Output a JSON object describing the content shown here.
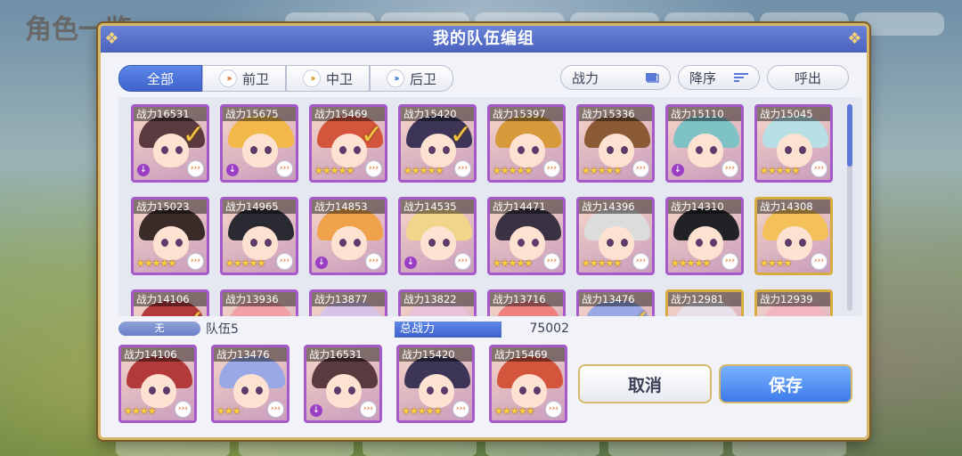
{
  "background": {
    "title": "角色一览"
  },
  "dialog": {
    "title": "我的队伍编组"
  },
  "filters": {
    "tabs": [
      {
        "label": "全部",
        "selected": true
      },
      {
        "label": "前卫"
      },
      {
        "label": "中卫"
      },
      {
        "label": "后卫"
      }
    ],
    "power_sort": "战力",
    "order": "降序",
    "recall": "呼出"
  },
  "roster": [
    {
      "power": "战力16531",
      "stars": "★",
      "checked": true,
      "down": true,
      "gold": false,
      "hair": "#5a3a3e"
    },
    {
      "power": "战力15675",
      "stars": "",
      "checked": false,
      "down": true,
      "gold": false,
      "hair": "#f2b84a"
    },
    {
      "power": "战力15469",
      "stars": "★★★★★",
      "checked": true,
      "down": false,
      "gold": false,
      "hair": "#d3553c"
    },
    {
      "power": "战力15420",
      "stars": "★★★★★",
      "checked": true,
      "down": false,
      "gold": false,
      "hair": "#3c3558"
    },
    {
      "power": "战力15397",
      "stars": "★★★★★",
      "checked": false,
      "down": false,
      "gold": false,
      "hair": "#d79a3a"
    },
    {
      "power": "战力15336",
      "stars": "★★★★★",
      "checked": false,
      "down": false,
      "gold": false,
      "hair": "#8a5a34"
    },
    {
      "power": "战力15110",
      "stars": "",
      "checked": false,
      "down": true,
      "gold": false,
      "hair": "#7fc2c6"
    },
    {
      "power": "战力15045",
      "stars": "★★★★★",
      "checked": false,
      "down": false,
      "gold": false,
      "hair": "#b9dfe6"
    },
    {
      "power": "战力15023",
      "stars": "★★★★★",
      "checked": false,
      "down": false,
      "gold": false,
      "hair": "#3a2a28"
    },
    {
      "power": "战力14965",
      "stars": "★★★★★",
      "checked": false,
      "down": false,
      "gold": false,
      "hair": "#2a2a33"
    },
    {
      "power": "战力14853",
      "stars": "",
      "checked": false,
      "down": true,
      "gold": false,
      "hair": "#f0a24a"
    },
    {
      "power": "战力14535",
      "stars": "",
      "checked": false,
      "down": true,
      "gold": false,
      "hair": "#f1d58a"
    },
    {
      "power": "战力14471",
      "stars": "★★★★★",
      "checked": false,
      "down": false,
      "gold": false,
      "hair": "#3a3142"
    },
    {
      "power": "战力14396",
      "stars": "★★★★★",
      "checked": false,
      "down": false,
      "gold": false,
      "hair": "#dcdcdc"
    },
    {
      "power": "战力14310",
      "stars": "★★★★★",
      "checked": false,
      "down": false,
      "gold": false,
      "hair": "#222226"
    },
    {
      "power": "战力14308",
      "stars": "★★★★",
      "checked": false,
      "down": false,
      "gold": true,
      "hair": "#f3c05a"
    },
    {
      "power": "战力14106",
      "stars": "",
      "checked": true,
      "down": false,
      "gold": false,
      "hair": "#b33a3a"
    },
    {
      "power": "战力13936",
      "stars": "",
      "checked": false,
      "down": false,
      "gold": false,
      "hair": "#f1a0a8"
    },
    {
      "power": "战力13877",
      "stars": "",
      "checked": false,
      "down": false,
      "gold": false,
      "hair": "#d7c3e6"
    },
    {
      "power": "战力13822",
      "stars": "",
      "checked": false,
      "down": false,
      "gold": false,
      "hair": "#e7c2d8"
    },
    {
      "power": "战力13716",
      "stars": "",
      "checked": false,
      "down": false,
      "gold": false,
      "hair": "#f08080"
    },
    {
      "power": "战力13476",
      "stars": "",
      "checked": true,
      "down": false,
      "gold": false,
      "hair": "#9aa8e6"
    },
    {
      "power": "战力12981",
      "stars": "",
      "checked": false,
      "down": false,
      "gold": true,
      "hair": "#e8e0e8"
    },
    {
      "power": "战力12939",
      "stars": "",
      "checked": false,
      "down": false,
      "gold": true,
      "hair": "#f2b6c2"
    }
  ],
  "team": {
    "tag": "无",
    "name": "队伍5",
    "total_label": "总战力",
    "total_value": "75002",
    "members": [
      {
        "power": "战力14106",
        "stars": "★★★★",
        "down": false,
        "hair": "#b33a3a"
      },
      {
        "power": "战力13476",
        "stars": "★★★",
        "down": false,
        "hair": "#9aa8e6"
      },
      {
        "power": "战力16531",
        "stars": "",
        "down": true,
        "hair": "#5a3a3e"
      },
      {
        "power": "战力15420",
        "stars": "★★★★★",
        "down": false,
        "hair": "#3c3558"
      },
      {
        "power": "战力15469",
        "stars": "★★★★★",
        "down": false,
        "hair": "#d3553c"
      }
    ]
  },
  "buttons": {
    "cancel": "取消",
    "save": "保存"
  }
}
